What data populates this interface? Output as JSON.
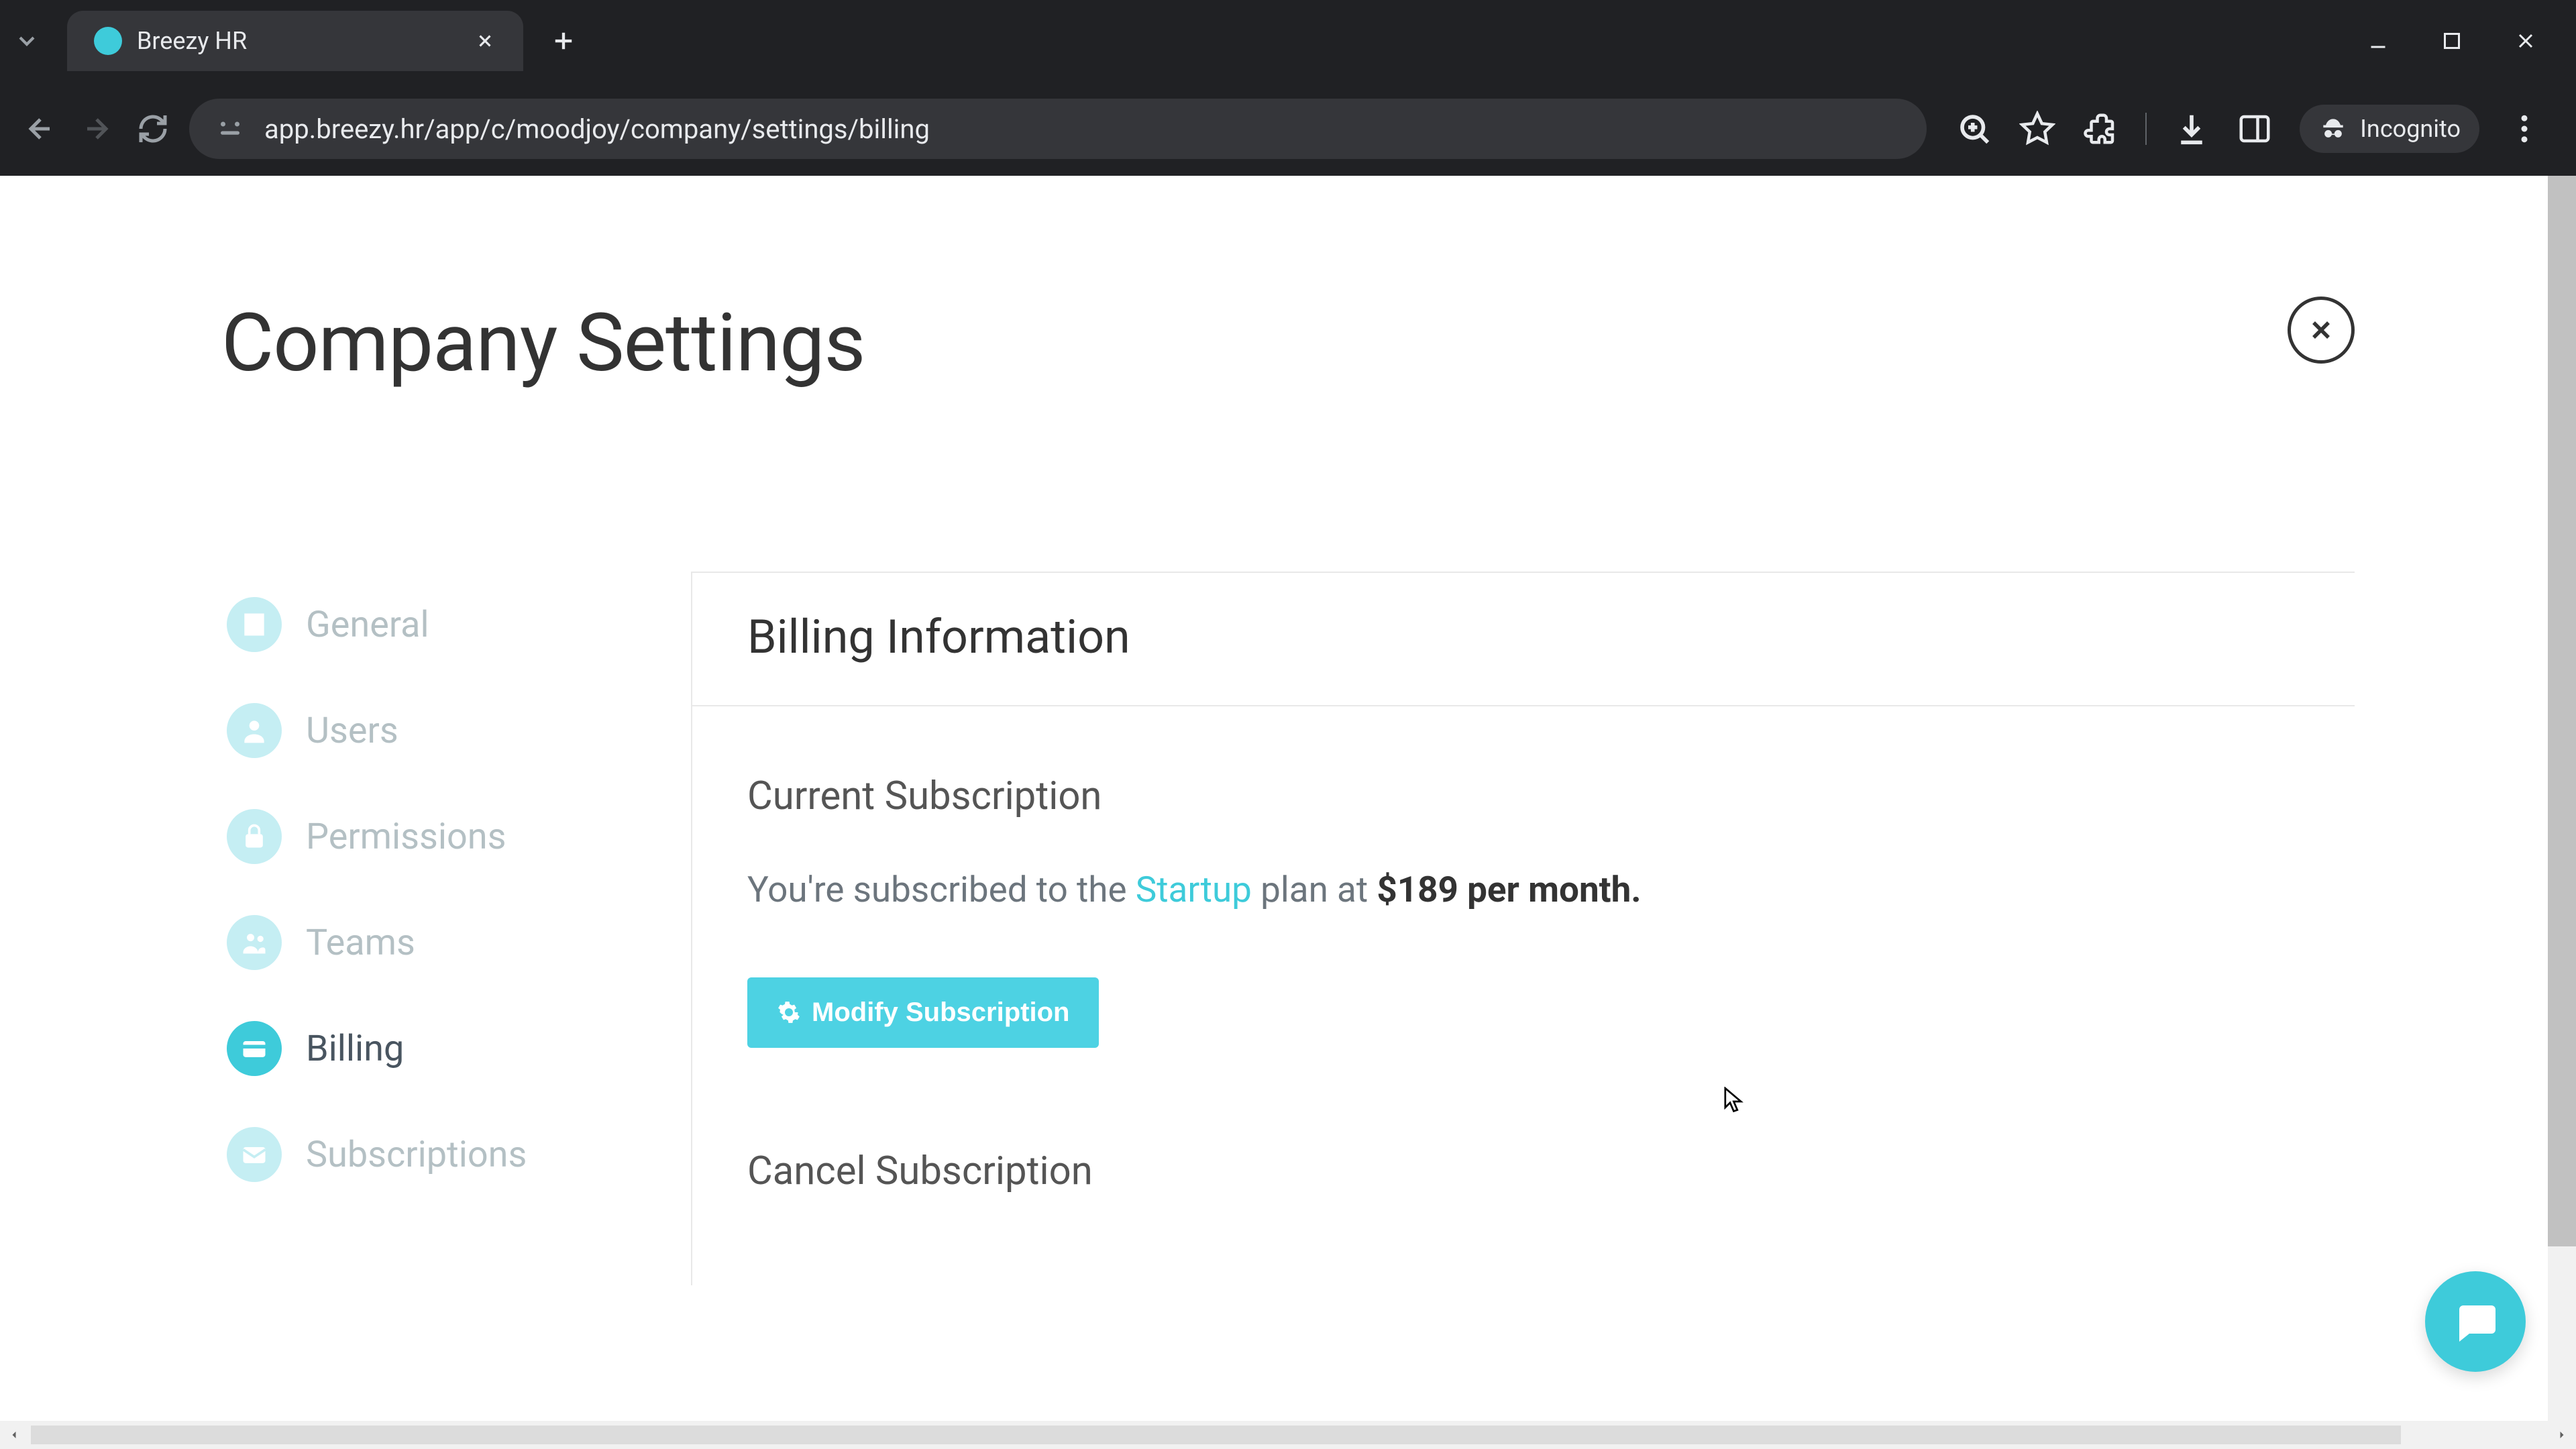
{
  "browser": {
    "tab_title": "Breezy HR",
    "url": "app.breezy.hr/app/c/moodjoy/company/settings/billing",
    "incognito_label": "Incognito"
  },
  "page": {
    "title": "Company Settings"
  },
  "sidebar": {
    "items": [
      {
        "label": "General",
        "icon": "building"
      },
      {
        "label": "Users",
        "icon": "user"
      },
      {
        "label": "Permissions",
        "icon": "lock"
      },
      {
        "label": "Teams",
        "icon": "team"
      },
      {
        "label": "Billing",
        "icon": "card",
        "active": true
      },
      {
        "label": "Subscriptions",
        "icon": "mail"
      }
    ]
  },
  "billing": {
    "header": "Billing Information",
    "current_title": "Current Subscription",
    "sub_prefix": "You're subscribed to the ",
    "plan_name": "Startup",
    "sub_mid": " plan at ",
    "price": "$189 per month.",
    "modify_label": "Modify Subscription",
    "cancel_title": "Cancel Subscription"
  }
}
